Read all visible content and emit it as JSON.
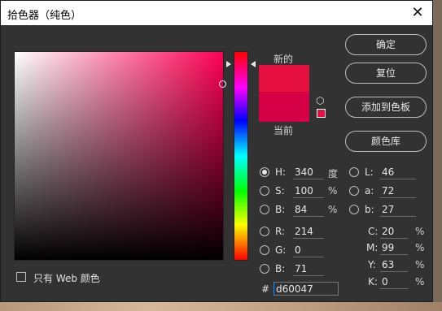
{
  "dialog": {
    "title": "拾色器（纯色）",
    "close": "✕"
  },
  "swatch": {
    "new_label": "新的",
    "current_label": "当前",
    "new_color": "#e5103f",
    "current_color": "#d60047"
  },
  "buttons": {
    "ok": "确定",
    "reset": "复位",
    "add_to_swatches": "添加到色板",
    "color_libraries": "颜色库"
  },
  "hsb": {
    "h_label": "H:",
    "h_value": "340",
    "h_unit": "度",
    "s_label": "S:",
    "s_value": "100",
    "s_unit": "%",
    "b_label": "B:",
    "b_value": "84",
    "b_unit": "%"
  },
  "rgb": {
    "r_label": "R:",
    "r_value": "214",
    "g_label": "G:",
    "g_value": "0",
    "b_label": "B:",
    "b_value": "71"
  },
  "lab": {
    "l_label": "L:",
    "l_value": "46",
    "a_label": "a:",
    "a_value": "72",
    "b_label": "b:",
    "b_value": "27"
  },
  "cmyk": {
    "c_label": "C:",
    "c_value": "20",
    "c_unit": "%",
    "m_label": "M:",
    "m_value": "99",
    "m_unit": "%",
    "y_label": "Y:",
    "y_value": "63",
    "y_unit": "%",
    "k_label": "K:",
    "k_value": "0",
    "k_unit": "%"
  },
  "hex": {
    "label": "#",
    "value": "d60047"
  },
  "web_only": {
    "label": "只有 Web 颜色",
    "checked": false
  },
  "selected_mode": "H"
}
